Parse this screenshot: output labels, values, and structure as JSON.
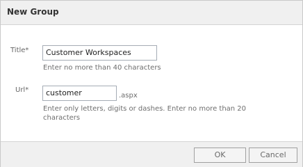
{
  "dialog": {
    "title": "New Group"
  },
  "form": {
    "title_label": "Title*",
    "title_value": "Customer Workspaces",
    "title_hint": "Enter no more than 40 characters",
    "url_label": "Url*",
    "url_value": "customer",
    "url_suffix": ".aspx",
    "url_hint": "Enter only letters, digits or dashes. Enter no more than 20 characters"
  },
  "buttons": {
    "ok": "OK",
    "cancel": "Cancel"
  }
}
